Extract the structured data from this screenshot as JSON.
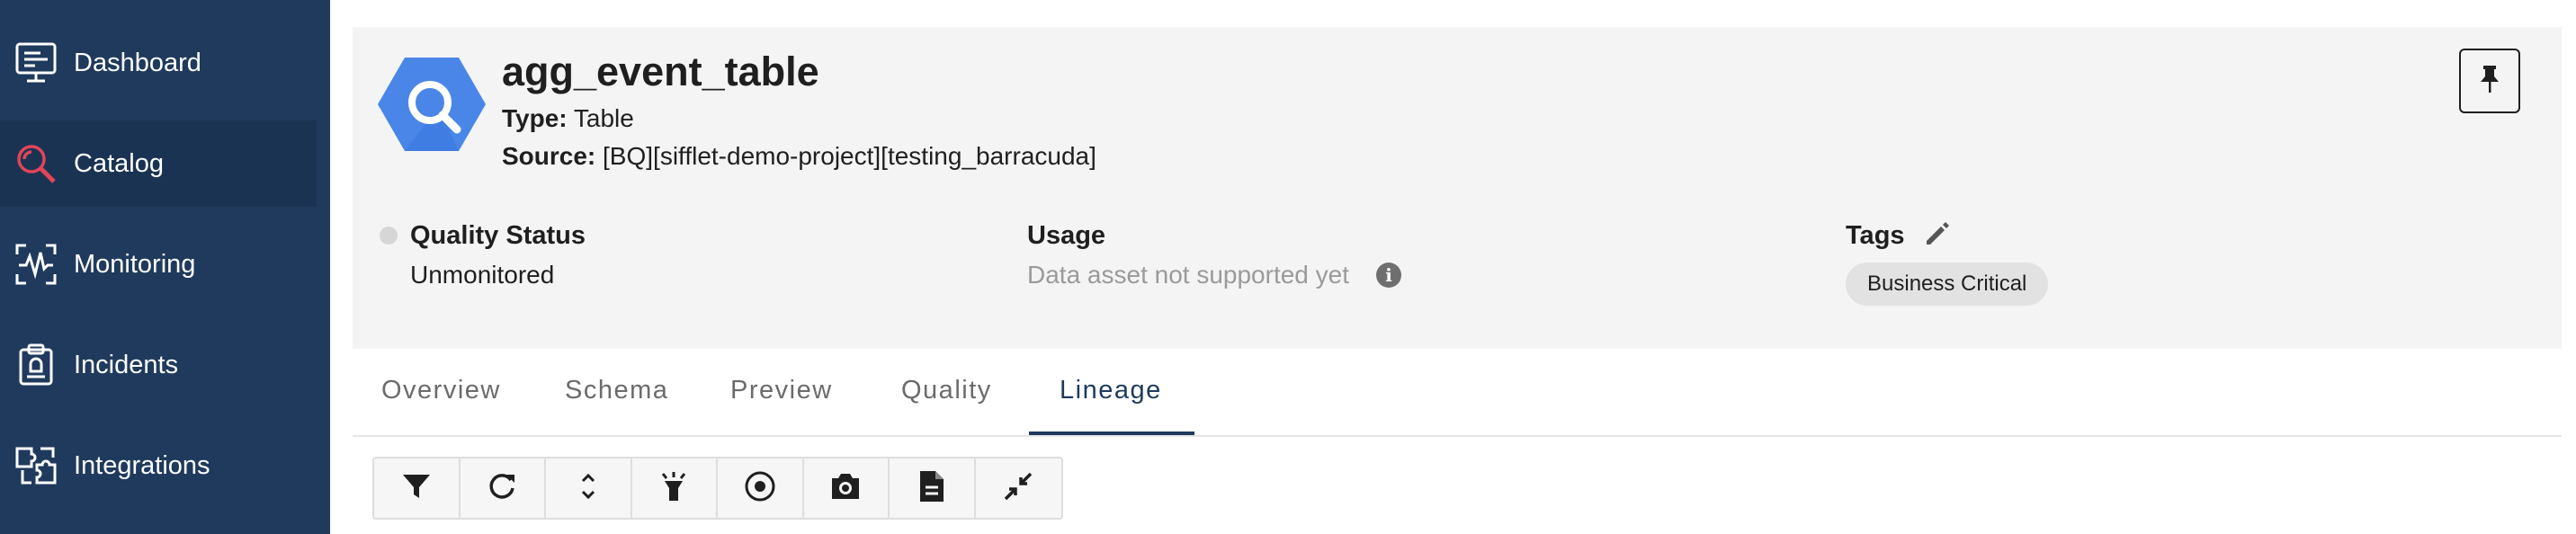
{
  "sidebar": {
    "items": [
      {
        "label": "Dashboard",
        "icon": "dashboard-icon"
      },
      {
        "label": "Catalog",
        "icon": "catalog-search-icon",
        "active": true
      },
      {
        "label": "Monitoring",
        "icon": "monitoring-icon"
      },
      {
        "label": "Incidents",
        "icon": "incidents-icon"
      },
      {
        "label": "Integrations",
        "icon": "integrations-icon"
      }
    ],
    "colors": {
      "background": "#1f3a5c",
      "active_background": "#1b3352",
      "catalog_icon": "#e0455a"
    }
  },
  "asset": {
    "name": "agg_event_table",
    "type_label": "Type:",
    "type_value": "Table",
    "source_label": "Source:",
    "source_value": "[BQ][sifflet-demo-project][testing_barracuda]",
    "logo_icon": "bigquery-logo-icon",
    "logo_color": "#4a86e8"
  },
  "quality": {
    "label": "Quality Status",
    "value": "Unmonitored"
  },
  "usage": {
    "label": "Usage",
    "value": "Data asset not supported yet"
  },
  "tags": {
    "label": "Tags",
    "items": [
      "Business Critical"
    ]
  },
  "tabs": [
    {
      "label": "Overview"
    },
    {
      "label": "Schema"
    },
    {
      "label": "Preview"
    },
    {
      "label": "Quality"
    },
    {
      "label": "Lineage",
      "active": true
    }
  ],
  "toolbar": {
    "buttons": [
      "filter-icon",
      "refresh-icon",
      "expand-collapse-icon",
      "highlight-icon",
      "focus-icon",
      "camera-icon",
      "document-icon",
      "collapse-arrows-icon"
    ]
  },
  "accent_color": "#1f3a5c"
}
